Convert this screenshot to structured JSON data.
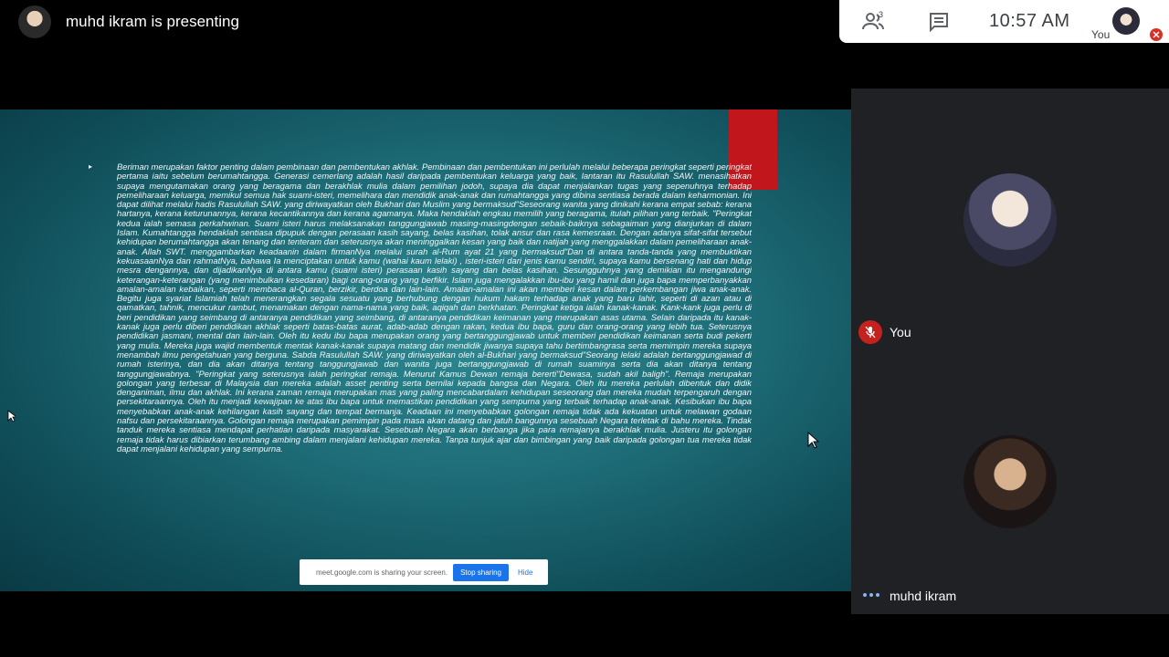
{
  "presenter": {
    "text": "muhd ikram is presenting"
  },
  "topbar": {
    "people_count": "3",
    "time": "10:57 AM",
    "self_label": "You",
    "icons": [
      "people-icon",
      "chat-icon",
      "mic-off-icon"
    ]
  },
  "slide": {
    "bullet": "▸",
    "body": "Beriman merupakan faktor penting dalam pembinaan dan pembentukan akhlak. Pembinaan dan pembentukan ini perlulah melalui beberapa peringkat seperti peringkat pertama iaitu sebelum berumahtangga. Generasi cemerlang adalah hasil daripada pembentukan keluarga yang baik, lantaran itu Rasulullah SAW. menasihatkan supaya mengutamakan orang yang beragama dan berakhlak mulia dalam pemilihan jodoh, supaya dia dapat menjalankan tugas yang sepenuhnya terhadap pemeliharaan keluarga, memikul semua hak suami-isteri, memelihara dan mendidik anak-anak dan rumahtangga yang dibina sentiasa berada dalam keharmonian. Ini dapat dilihat melalui hadis Rasulullah SAW. yang diriwayatkan oleh Bukhari dan Muslim yang bermaksud\"Seseorang wanita yang dinikahi kerana empat sebab: kerana hartanya, kerana keturunannya, kerana kecantikannya dan kerana agamanya. Maka hendaklah engkau memilih yang beragama, itulah pilihan yang terbaik. \"Peringkat kedua ialah semasa perkahwinan. Suami isteri harus melaksanakan tanggungjawab masing-masingdengan sebaik-baiknya sebagaiman yang dianjurkan di dalam Islam. Kumahtangga hendaklah sentiasa dipupuk dengan perasaan kasih sayang, belas kasihan, tolak ansur dan rasa kemesraan. Dengan adanya sifat-sifat tersebut kehidupan berumahtangga akan tenang dan tenteram dan seterusnya akan meninggalkan kesan yang baik dan natijah yang menggalakkan dalam pemeliharaan anak-anak. Allah SWT. menggambarkan keadaanin dalam firmanNya melalui surah al-Rum ayat 21 yang bermaksud\"Dan di antara tanda-tanda yang membuktikan kekuasaanNya dan rahmatNya, bahawa Ia menciptakan untuk kamu (wahai kaum lelaki) , isteri-isteri dari jenis kamu sendiri, supaya kamu bersenang hati dan hidup mesra dengannya, dan dijadikanNya di antara kamu (suami isteri) perasaan kasih sayang dan belas kasihan. Sesungguhnya yang demikian itu mengandungi keterangan-keterangan (yang menimbulkan kesedaran) bagi orang-orang yang berfikir. Islam juga mengalakkan ibu-ibu yang hamil dan juga bapa memperbanyakkan amalan-amalan kebaikan, seperti membaca al-Quran, berzikir, berdoa dan lain-lain. Amalan-amalan ini akan memberi kesan dalam perkembangan jiwa anak-anak. Begitu juga syariat Islamiah telah menerangkan segala sesuatu yang berhubung dengan hukum hakam terhadap anak yang baru lahir, seperti di azan atau di qamatkan, tahnik, mencukur rambut, menamakan dengan nama-nama yang baik, aqiqah dan berkhatan. Peringkat ketiga ialah kanak-kanak. Kank-kank juga perlu di beri pendidikan yang seimbang di antaranya pendidikan yang seimbang, di antaranya pendidikan keimanan yang merupakan asas utama. Selain daripada itu kanak-kanak juga perlu diberi pendidikan akhlak seperti batas-batas aurat, adab-adab dengan rakan, kedua ibu bapa, guru dan orang-orang yang lebih tua. Seterusnya pendidikan jasmani, mental dan lain-lain. Oleh itu kedu ibu bapa merupakan orang yang bertanggungjawab untuk memberi pendidikan keimanan serta budi pekerti yang mulia. Mereka juga wajid membentuk mentak kanak-kanak supaya matang dan mendidik jiwanya supaya tahu bertimbangrasa serta memimpin mereka supaya menambah ilmu pengetahuan yang berguna. Sabda Rasulullah SAW. yang diriwayatkan oleh al-Bukhari yang bermaksud\"Seorang lelaki adalah bertanggungjawad di rumah isterinya, dan dia akan ditanya tentang tanggungjawab dan wanita juga bertanggungjawab di rumah suaminya serta dia akan ditanya tentang tanggungjawabnya. \"Peringkat yang seterusnya ialah peringkat remaja. Menurut Kamus Dewan remaja bererti\"Dewasa, sudah akil baligh\". Remaja merupakan golongan yang terbesar di Malaysia dan mereka adalah asset penting serta bernilai kepada bangsa dan Negara. Oleh itu mereka perlulah dibentuk dan didik denganiman, ilmu dan akhlak. Ini kerana zaman remaja merupakan mas yang paling mencabardalam kehidupan seseorang dan mereka mudah terpengaruh dengan persekitaraannya. Oleh itu menjadi kewajipan ke atas ibu bapa untuk memastikan pendidikan yang sempurna yang terbaik terhadap anak-anak. Kesibukan ibu bapa menyebabkan anak-anak kehilangan kasih sayang dan tempat bermanja. Keadaan ini menyebabkan golongan remaja tidak ada kekuatan untuk melawan godaan nafsu dan persekitaraannya. Golongan remaja merupakan pemimpin pada masa akan datang dan jatuh bangunnya sesebuah Negara terletak di bahu mereka. Tindak tanduk mereka sentiasa mendapat perhatian daripada masyarakat. Sesebuah Negara akan berbanga jika para remajanya berakhlak mulia. Justeru itu golongan remaja tidak harus dibiarkan terumbang ambing dalam menjalani kehidupan mereka. Tanpa tunjuk ajar dan bimbingan yang baik daripada golongan tua mereka tidak dapat menjalani kehidupan yang sempurna."
  },
  "share_notice": {
    "message": "meet.google.com is sharing your screen.",
    "stop_label": "Stop sharing",
    "hide_label": "Hide"
  },
  "participants": {
    "you_label": "You",
    "host_label": "muhd ikram"
  },
  "colors": {
    "accent": "#1a73e8",
    "mute": "#c5221f",
    "slide_bg": "#1e6d78",
    "red_block": "#c0161c"
  }
}
